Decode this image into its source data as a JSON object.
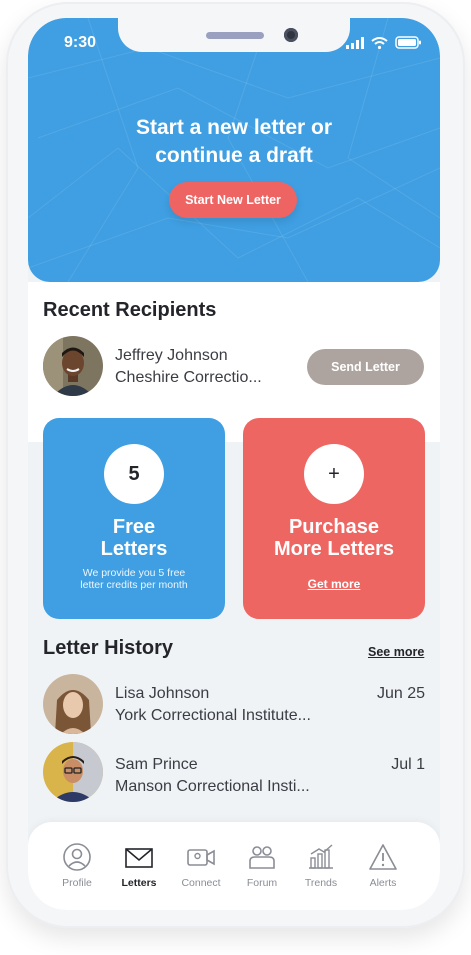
{
  "status_bar": {
    "time": "9:30"
  },
  "hero": {
    "title_line1": "Start a new letter or",
    "title_line2": "continue a draft",
    "button_label": "Start New Letter",
    "background_color": "#3f9fe2"
  },
  "recent_recipients": {
    "title": "Recent Recipients",
    "items": [
      {
        "name": "Jeffrey Johnson",
        "facility": "Cheshire Correctio...",
        "action_label": "Send Letter"
      }
    ]
  },
  "cards": {
    "free": {
      "count": "5",
      "title_line1": "Free",
      "title_line2": "Letters",
      "note_line1": "We provide you 5 free",
      "note_line2": "letter credits per month",
      "color": "#3f9fe2"
    },
    "purchase": {
      "icon": "+",
      "title_line1": "Purchase",
      "title_line2": "More Letters",
      "link_label": "Get more",
      "color": "#ee6662"
    }
  },
  "letter_history": {
    "title": "Letter History",
    "see_more_label": "See more",
    "items": [
      {
        "name": "Lisa Johnson",
        "facility": "York Correctional Institute...",
        "date": "Jun 25"
      },
      {
        "name": "Sam Prince",
        "facility": "Manson Correctional Insti...",
        "date": "Jul 1"
      }
    ]
  },
  "tabs": [
    {
      "label": "Profile",
      "icon": "profile-icon",
      "active": false
    },
    {
      "label": "Letters",
      "icon": "letters-icon",
      "active": true
    },
    {
      "label": "Connect",
      "icon": "connect-icon",
      "active": false
    },
    {
      "label": "Forum",
      "icon": "forum-icon",
      "active": false
    },
    {
      "label": "Trends",
      "icon": "trends-icon",
      "active": false
    },
    {
      "label": "Alerts",
      "icon": "alerts-icon",
      "active": false
    }
  ]
}
